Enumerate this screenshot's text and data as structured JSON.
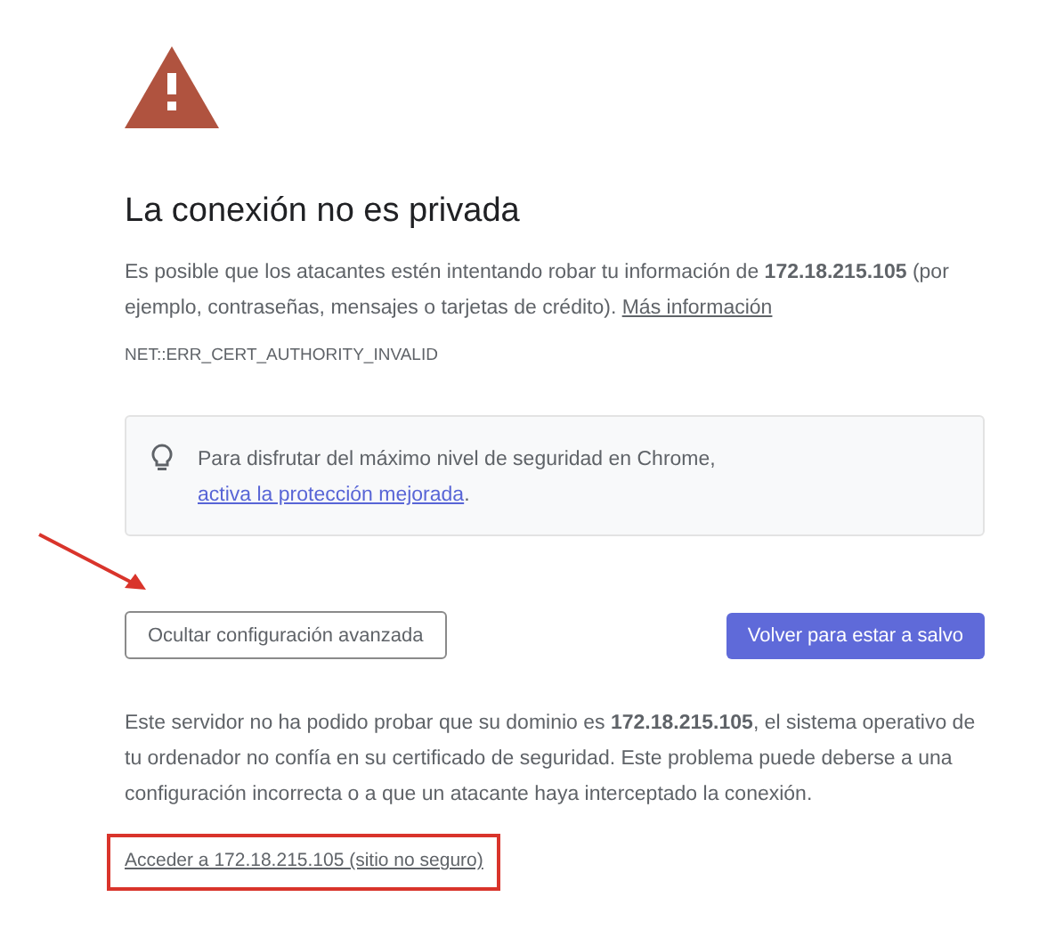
{
  "title": "La conexión no es privada",
  "intro": "Es posible que los atacantes estén intentando robar tu información de **172.18.215.105** (por ejemplo, contraseñas, mensajes o tarjetas de crédito).",
  "intro_link": "Más información",
  "error_code": "NET::ERR_CERT_AUTHORITY_INVALID",
  "tip": {
    "text": "Para disfrutar del máximo nivel de seguridad en Chrome,",
    "link": "activa la protección mejorada",
    "end": "."
  },
  "buttons": [
    {
      "label": "Ocultar configuración avanzada",
      "kind": "secondary"
    },
    {
      "label": "Volver para estar a salvo",
      "kind": "primary"
    }
  ],
  "details": "Este servidor no ha podido probar que su dominio es **172.18.215.105**, el sistema operativo de tu ordenador no confía en su certificado de seguridad. Este problema puede deberse a una configuración incorrecta o a que un atacante haya interceptado la conexión.",
  "proceed_link": "Acceder a 172.18.215.105 (sitio no seguro)"
}
